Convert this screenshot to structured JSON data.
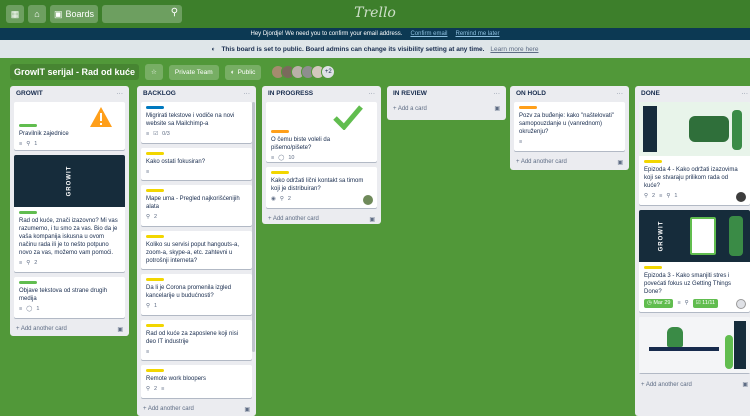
{
  "topbar": {
    "boards_label": "Boards",
    "logo": "Trello"
  },
  "banner": {
    "message": "Hey Djordje! We need you to confirm your email address.",
    "confirm": "Confirm email",
    "remind": "Remind me later"
  },
  "visibility": {
    "message": "This board is set to public. Board admins can change its visibility setting at any time.",
    "learn": "Learn more here"
  },
  "board": {
    "title": "GrowIT serijal - Rad od kuće",
    "team": "Private Team",
    "visibility": "Public",
    "member_more": "+2"
  },
  "lists": [
    {
      "title": "GROWIT",
      "add": "+ Add another card",
      "cards": [
        {
          "label": "#61bd4f",
          "text": "Pravilnik zajednice",
          "b1": "1"
        },
        {
          "label": "#61bd4f",
          "text": "Rad od kuće, znači izazovno? Mi vas razumemo, i tu smo za vas. Bio da je vaša kompanija iskusna u ovom načinu rada ili je to nešto potpuno novo za vas, možemo vam pomoći.",
          "b1": "2"
        },
        {
          "label": "#61bd4f",
          "text": "Objave tekstova od strane drugih medija",
          "b1": "1"
        }
      ]
    },
    {
      "title": "BACKLOG",
      "add": "+ Add another card",
      "cards": [
        {
          "label": "#0079bf",
          "text": "Migrirati tekstove i vodiče na novi website sa Mailchimp-a",
          "b1": "0/3"
        },
        {
          "label": "#f2d600",
          "text": "Kako ostati fokusiran?"
        },
        {
          "label": "#f2d600",
          "text": "Mape uma - Pregled najkorišćenijih alata",
          "b1": "2"
        },
        {
          "label": "#f2d600",
          "text": "Koliko su servisi poput hangouts-a, zoom-a, skype-a, etc. zahtevni u potrošnji interneta?"
        },
        {
          "label": "#f2d600",
          "text": "Da li je Corona promenila izgled kancelarije u budućnosti?",
          "b1": "1"
        },
        {
          "label": "#f2d600",
          "text": "Rad od kuće za zaposlene koji nisi deo IT industrije"
        },
        {
          "label": "#f2d600",
          "text": "Remote work bloopers",
          "b1": "2"
        }
      ]
    },
    {
      "title": "IN PROGRESS",
      "add": "+ Add another card",
      "cards": [
        {
          "label": "#ff9f1a",
          "text": "O čemu biste voleli da pišemo/pišete?",
          "b1": "10"
        },
        {
          "label": "#f2d600",
          "text": "Kako održati lični kontakt sa timom koji je distribuiran?",
          "b1": "2"
        }
      ]
    },
    {
      "title": "IN REVIEW",
      "add": "+ Add a card",
      "cards": []
    },
    {
      "title": "ON HOLD",
      "add": "+ Add another card",
      "cards": [
        {
          "label": "#ff9f1a",
          "text": "Pozv za buđenje: kako \"naštelovati\" samopouzdanje u (vanrednom) okruženju?"
        }
      ]
    },
    {
      "title": "DONE",
      "add": "+ Add another card",
      "cards": [
        {
          "label": "#f2d600",
          "text": "Epizoda 4 - Kako održati izazovima koji se stvaraju prilikom rada od kuće?",
          "b1": "2",
          "b2": "1"
        },
        {
          "label": "#f2d600",
          "text": "Epizoda 3 - Kako smanjiti stres i povećati fokus uz Getting Things Done?",
          "due": "Mar 29",
          "check": "11/11"
        }
      ]
    }
  ]
}
